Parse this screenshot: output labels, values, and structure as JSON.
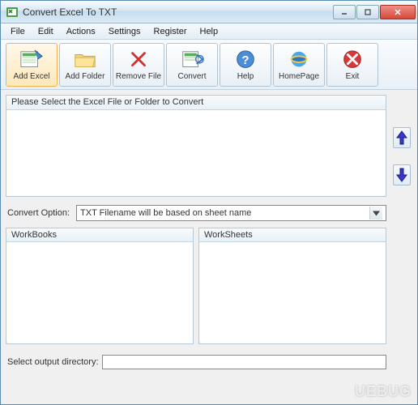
{
  "window": {
    "title": "Convert Excel To TXT"
  },
  "menu": {
    "file": "File",
    "edit": "Edit",
    "actions": "Actions",
    "settings": "Settings",
    "register": "Register",
    "help": "Help"
  },
  "toolbar": {
    "add_excel": "Add Excel",
    "add_folder": "Add Folder",
    "remove_file": "Remove File",
    "convert": "Convert",
    "help": "Help",
    "homepage": "HomePage",
    "exit": "Exit"
  },
  "panels": {
    "file_list_header": "Please Select the Excel File or Folder to Convert",
    "convert_option_label": "Convert Option:",
    "convert_option_value": "TXT Filename will be based on sheet name",
    "workbooks_header": "WorkBooks",
    "worksheets_header": "WorkSheets",
    "output_label": "Select  output directory:",
    "output_value": ""
  },
  "watermark": "UEBUG"
}
